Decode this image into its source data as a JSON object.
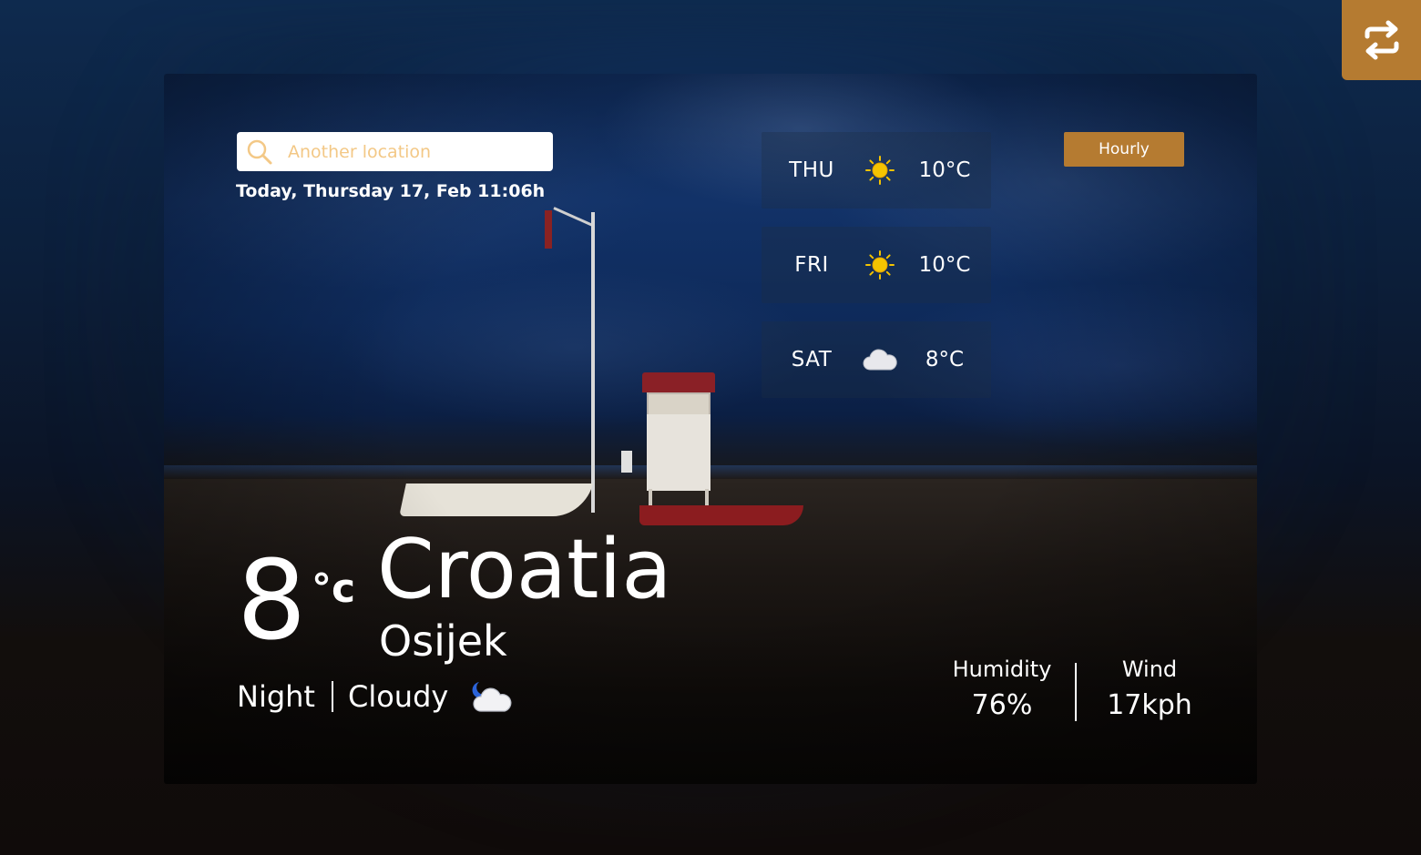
{
  "search": {
    "placeholder": "Another location"
  },
  "date_text": "Today, Thursday 17, Feb 11:06h",
  "forecast": [
    {
      "day": "THU",
      "icon": "sun-icon",
      "temp": "10°C"
    },
    {
      "day": "FRI",
      "icon": "sun-icon",
      "temp": "10°C"
    },
    {
      "day": "SAT",
      "icon": "cloud-icon",
      "temp": "8°C"
    }
  ],
  "hourly_label": "Hourly",
  "current": {
    "temp": "8",
    "unit": "°c",
    "country": "Croatia",
    "city": "Osijek",
    "time_of_day": "Night",
    "condition": "Cloudy",
    "condition_icon": "night-cloud-icon"
  },
  "stats": {
    "humidity_label": "Humidity",
    "humidity_value": "76%",
    "wind_label": "Wind",
    "wind_value": "17kph"
  },
  "colors": {
    "accent": "#b57b31",
    "sun": "#f5c400",
    "placeholder": "#f3c886"
  },
  "toggle_icon": "repeat-arrows-icon"
}
